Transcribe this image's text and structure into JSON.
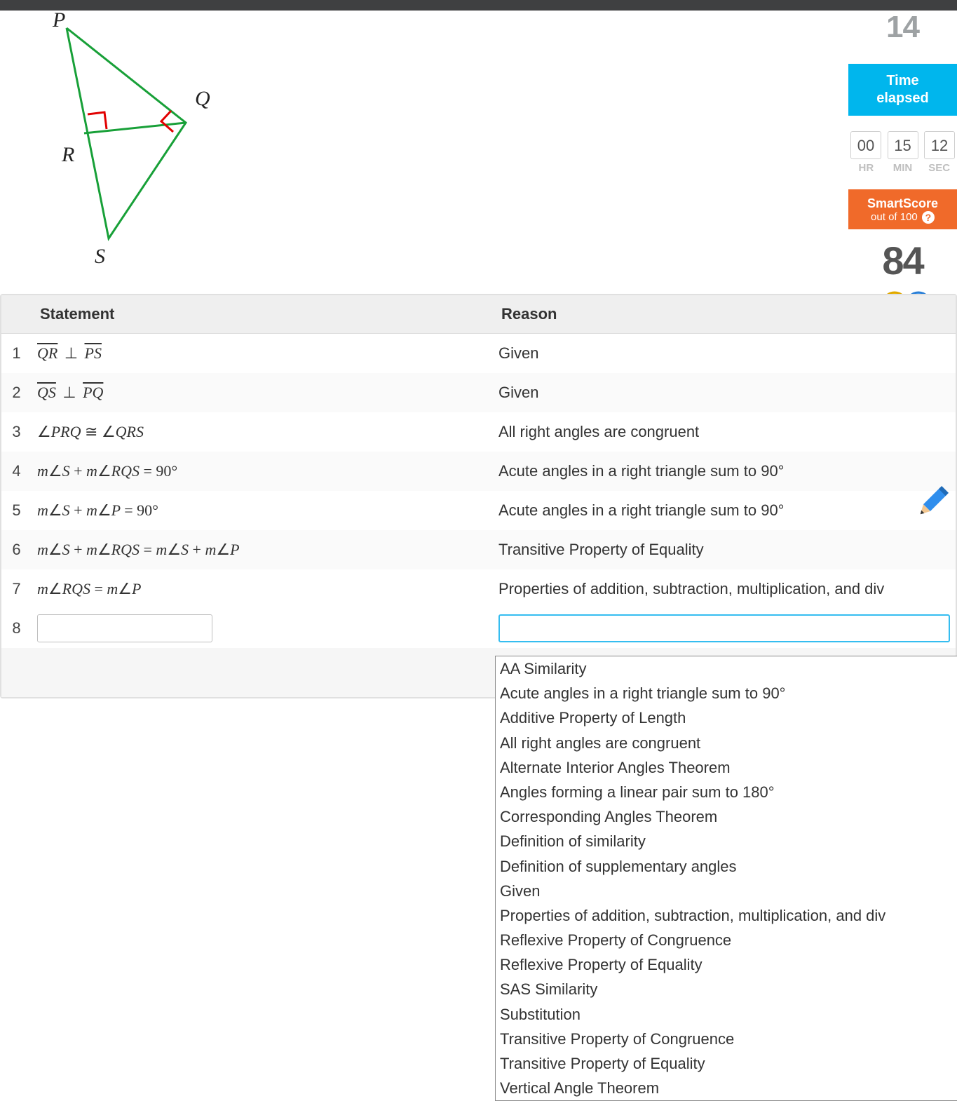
{
  "diagram": {
    "labels": {
      "P": "P",
      "Q": "Q",
      "R": "R",
      "S": "S"
    }
  },
  "sidebar": {
    "questions_value": "14",
    "time_elapsed_label": "Time\nelapsed",
    "time": {
      "hr": "00",
      "min": "15",
      "sec": "12"
    },
    "time_labels": {
      "hr": "HR",
      "min": "MIN",
      "sec": "SEC"
    },
    "smartscore_title": "SmartScore",
    "smartscore_sub": "out of 100",
    "score_value": "84"
  },
  "proof": {
    "header_statement": "Statement",
    "header_reason": "Reason",
    "rows": [
      {
        "n": "1",
        "stmt_html": "<span class='ovl'>QR</span> <span class='perp'>⊥</span> <span class='ovl'>PS</span>",
        "reason": "Given"
      },
      {
        "n": "2",
        "stmt_html": "<span class='ovl'>QS</span> <span class='perp'>⊥</span> <span class='ovl'>PQ</span>",
        "reason": "Given"
      },
      {
        "n": "3",
        "stmt_html": "<span class='ang'>∠</span>PRQ <span class='up'>≅</span> <span class='ang'>∠</span>QRS",
        "reason": "All right angles are congruent"
      },
      {
        "n": "4",
        "stmt_html": "m<span class='ang'>∠</span>S <span class='up'>+</span> m<span class='ang'>∠</span>RQS <span class='up'>= 90°</span>",
        "reason": "Acute angles in a right triangle sum to 90°"
      },
      {
        "n": "5",
        "stmt_html": "m<span class='ang'>∠</span>S <span class='up'>+</span> m<span class='ang'>∠</span>P <span class='up'>= 90°</span>",
        "reason": "Acute angles in a right triangle sum to 90°"
      },
      {
        "n": "6",
        "stmt_html": "m<span class='ang'>∠</span>S <span class='up'>+</span> m<span class='ang'>∠</span>RQS <span class='up'>=</span> m<span class='ang'>∠</span>S <span class='up'>+</span> m<span class='ang'>∠</span>P",
        "reason": "Transitive Property of Equality"
      },
      {
        "n": "7",
        "stmt_html": "m<span class='ang'>∠</span>RQS <span class='up'>=</span> m<span class='ang'>∠</span>P",
        "reason": "Properties of addition, subtraction, multiplication, and div"
      }
    ],
    "input_row_num": "8"
  },
  "dropdown": {
    "options": [
      "AA Similarity",
      "Acute angles in a right triangle sum to 90°",
      "Additive Property of Length",
      "All right angles are congruent",
      "Alternate Interior Angles Theorem",
      "Angles forming a linear pair sum to 180°",
      "Corresponding Angles Theorem",
      "Definition of similarity",
      "Definition of supplementary angles",
      "Given",
      "Properties of addition, subtraction, multiplication, and div",
      "Reflexive Property of Congruence",
      "Reflexive Property of Equality",
      "SAS Similarity",
      "Substitution",
      "Transitive Property of Congruence",
      "Transitive Property of Equality",
      "Vertical Angle Theorem"
    ]
  }
}
